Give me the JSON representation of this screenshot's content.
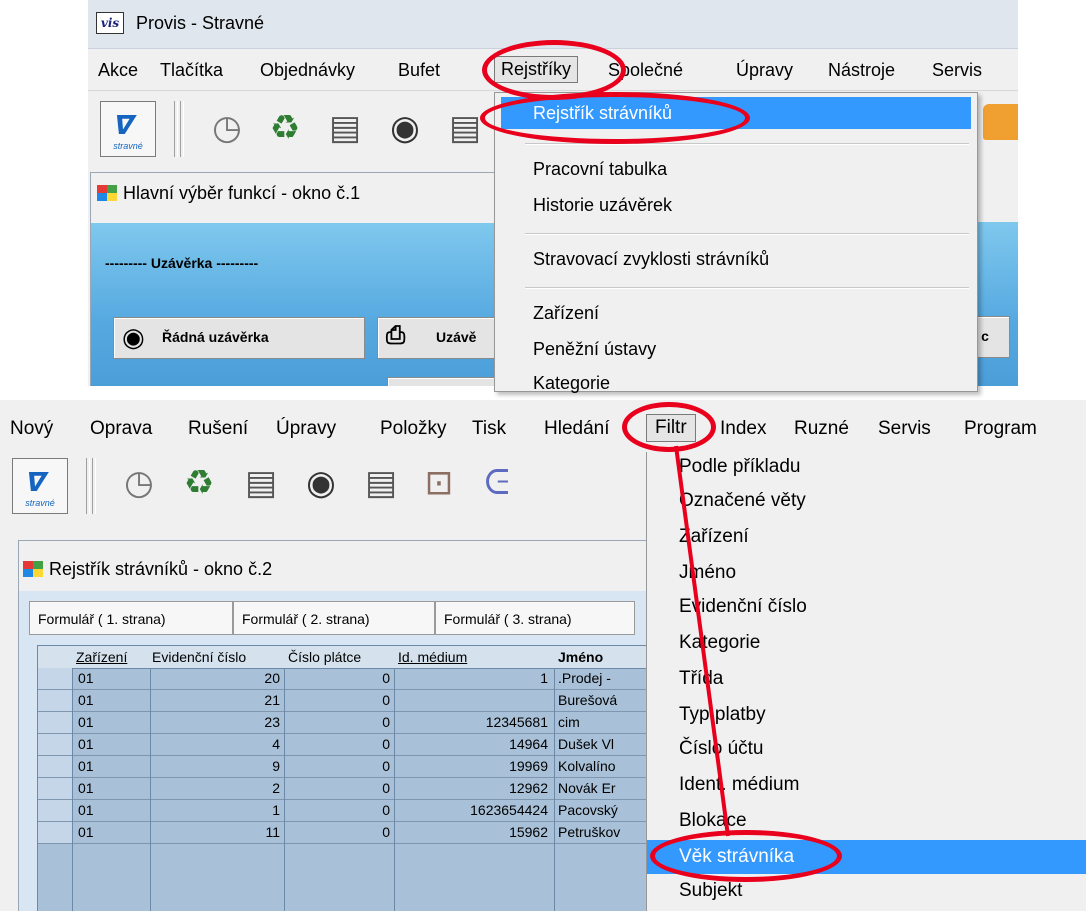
{
  "top": {
    "title": "Provis - Stravné",
    "logo_text": "vis",
    "menu": [
      "Akce",
      "Tlačítka",
      "Objednávky",
      "Bufet",
      "Rejstříky",
      "Společné",
      "Úpravy",
      "Nástroje",
      "Servis"
    ],
    "toolbar_logo_label": "stravné",
    "window_title": "Hlavní výběr funkcí - okno č.1",
    "section_label": "--------- Uzávěrka ---------",
    "buttons": [
      "Řádná uzávěrka",
      "Uzávě",
      "xp. c"
    ],
    "dropdown": {
      "items": [
        "Rejstřík strávníků",
        "Pracovní tabulka",
        "Historie uzávěrek",
        "Stravovací zvyklosti strávníků",
        "Zařízení",
        "Peněžní ústavy",
        "Kategorie"
      ],
      "highlighted": "Rejstřík strávníků"
    }
  },
  "bottom": {
    "menu": [
      "Nový",
      "Oprava",
      "Rušení",
      "Úpravy",
      "Položky",
      "Tisk",
      "Hledání",
      "Filtr",
      "Index",
      "Ruzné",
      "Servis",
      "Program"
    ],
    "toolbar_logo_label": "stravné",
    "window_title": "Rejstřík strávníků - okno č.2",
    "tabs": [
      "Formulář ( 1. strana)",
      "Formulář ( 2. strana)",
      "Formulář ( 3. strana)"
    ],
    "table": {
      "headers": [
        "Zařízení",
        "Evidenční číslo",
        "Číslo plátce",
        "Id. médium",
        "Jméno"
      ],
      "rows": [
        [
          "01",
          "20",
          "0",
          "1",
          ".Prodej -"
        ],
        [
          "01",
          "21",
          "0",
          "",
          "Burešová"
        ],
        [
          "01",
          "23",
          "0",
          "12345681",
          "cim"
        ],
        [
          "01",
          "4",
          "0",
          "14964",
          "Dušek Vl"
        ],
        [
          "01",
          "9",
          "0",
          "19969",
          "Kolvalíno"
        ],
        [
          "01",
          "2",
          "0",
          "12962",
          "Novák Er"
        ],
        [
          "01",
          "1",
          "0",
          "1623654424",
          "Pacovský"
        ],
        [
          "01",
          "11",
          "0",
          "15962",
          "Petruškov"
        ]
      ]
    },
    "dropdown": {
      "items": [
        "Podle příkladu",
        "Označené věty",
        "Zařízení",
        "Jméno",
        "Evidenční číslo",
        "Kategorie",
        "Třída",
        "Typ platby",
        "Číslo účtu",
        "Ident. médium",
        "Blokace",
        "Věk strávníka",
        "Subjekt"
      ],
      "highlighted": "Věk strávníka"
    }
  },
  "colors": {
    "annotation_red": "#e8001c",
    "menu_highlight": "#3399ff",
    "panel_blue": "#56a9e0",
    "grid_blue": "#a9c1d8"
  }
}
